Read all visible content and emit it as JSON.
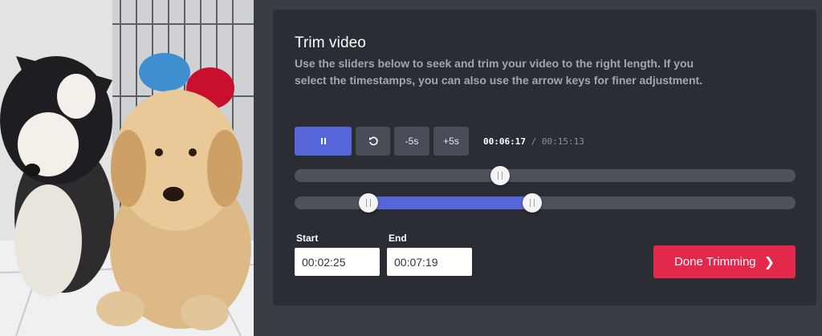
{
  "video_preview": {
    "description_icon": "video-frame"
  },
  "trim": {
    "title": "Trim video",
    "description": "Use the sliders below to seek and trim your video to the right length. If you select the timestamps, you can also use the arrow keys for finer adjustment."
  },
  "controls": {
    "play_state_icon": "pause-icon",
    "restart_icon": "restart-icon",
    "back_label": "-5s",
    "forward_label": "+5s",
    "current_time": "00:06:17",
    "separator": "/",
    "total_time": "00:15:13"
  },
  "seek": {
    "position_fraction": 0.41
  },
  "trim_range": {
    "start_fraction": 0.148,
    "end_fraction": 0.475
  },
  "fields": {
    "start_label": "Start",
    "start_value": "00:02:25",
    "end_label": "End",
    "end_value": "00:07:19"
  },
  "done": {
    "label": "Done Trimming",
    "icon": "chevron-right-icon"
  },
  "colors": {
    "accent": "#5767d9",
    "done": "#e3294b",
    "panel": "#2b2d35",
    "background": "#3a3c45"
  }
}
